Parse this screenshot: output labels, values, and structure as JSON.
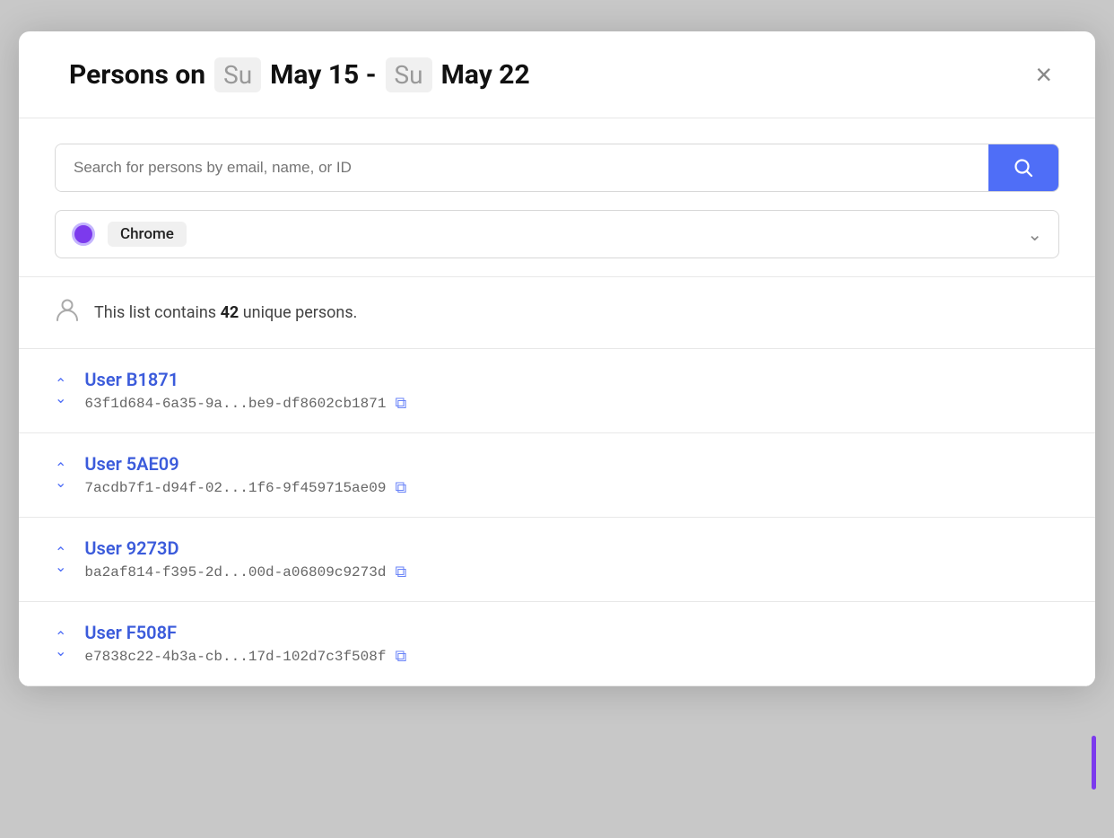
{
  "modal": {
    "title_prefix": "Persons on",
    "date_start_badge": "Su",
    "date_start": "May 15 -",
    "date_end_badge": "Su",
    "date_end": "May 22",
    "close_label": "×"
  },
  "search": {
    "placeholder": "Search for persons by email, name, or ID",
    "button_icon": "🔍"
  },
  "filter": {
    "label": "Chrome",
    "dot_color": "#7c3aed",
    "dot_border_color": "#c4b5fd"
  },
  "summary": {
    "text_prefix": "This list contains ",
    "count": "42",
    "text_suffix": " unique persons."
  },
  "users": [
    {
      "name": "User B1871",
      "id": "63f1d684-6a35-9a...be9-df8602cb1871"
    },
    {
      "name": "User 5AE09",
      "id": "7acdb7f1-d94f-02...1f6-9f459715ae09"
    },
    {
      "name": "User 9273D",
      "id": "ba2af814-f395-2d...00d-a06809c9273d"
    },
    {
      "name": "User F508F",
      "id": "e7838c22-4b3a-cb...17d-102d7c3f508f"
    }
  ],
  "colors": {
    "accent_blue": "#4f6ef7",
    "accent_purple": "#7c3aed",
    "border": "#e8e8e8"
  }
}
